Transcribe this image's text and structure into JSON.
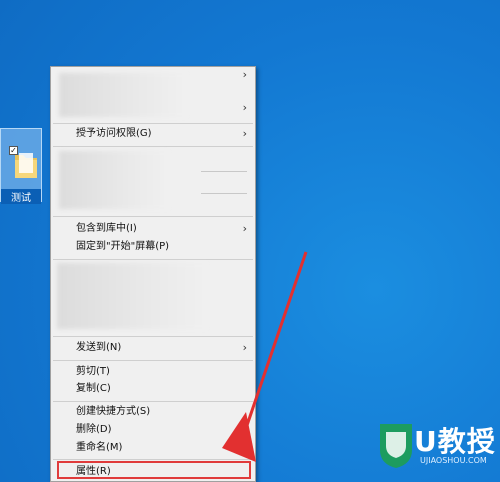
{
  "desktop": {
    "icon_label": "测试",
    "icon_checked": "✓"
  },
  "menu": {
    "items": [
      {
        "label": "授予访问权限(G)",
        "submenu": true
      },
      {
        "label": "包含到库中(I)",
        "submenu": true
      },
      {
        "label": "固定到\"开始\"屏幕(P)",
        "submenu": false
      },
      {
        "label": "发送到(N)",
        "submenu": true
      },
      {
        "label": "剪切(T)",
        "submenu": false
      },
      {
        "label": "复制(C)",
        "submenu": false
      },
      {
        "label": "创建快捷方式(S)",
        "submenu": false
      },
      {
        "label": "删除(D)",
        "submenu": false
      },
      {
        "label": "重命名(M)",
        "submenu": false
      },
      {
        "label": "属性(R)",
        "submenu": false
      }
    ],
    "submenu_arrow": "›"
  },
  "watermark": {
    "text": "U教授",
    "url": "UJIAOSHOU.COM"
  },
  "colors": {
    "desktop": "#1378d2",
    "highlight": "#e03b3b",
    "arrow": "#e23030"
  }
}
